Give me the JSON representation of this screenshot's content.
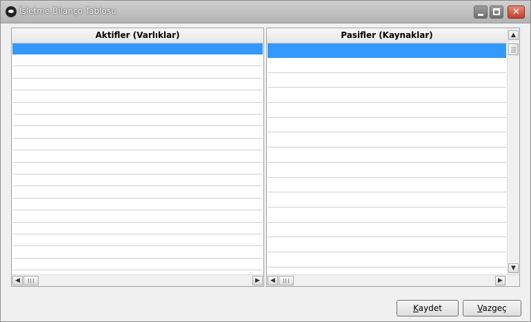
{
  "window": {
    "title": "İşletme Bilanço Tablosu",
    "icon": "app-logo-icon"
  },
  "titlebar_buttons": {
    "minimize": "minimize-icon",
    "maximize": "maximize-icon",
    "close": "close-icon",
    "close_glyph": "✕"
  },
  "left_panel": {
    "header": "Aktifler (Varlıklar)",
    "selected_row": 0
  },
  "right_panel": {
    "header": "Pasifler (Kaynaklar)",
    "selected_row": 0
  },
  "scroll_glyphs": {
    "left": "◀",
    "right": "▶",
    "up": "▲",
    "down": "▼"
  },
  "buttons": {
    "save_access": "K",
    "save_rest": "aydet",
    "cancel_access": "V",
    "cancel_rest": "azgeç"
  },
  "colors": {
    "selection": "#3399ff",
    "close_button": "#c4402a"
  }
}
